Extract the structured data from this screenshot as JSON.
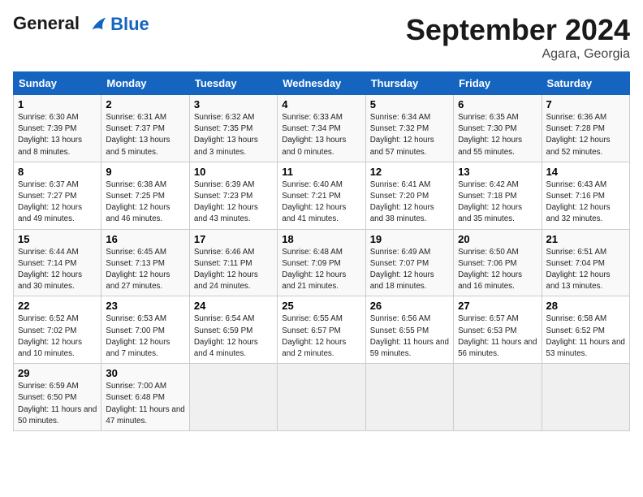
{
  "header": {
    "logo_line1": "General",
    "logo_line2": "Blue",
    "month": "September 2024",
    "location": "Agara, Georgia"
  },
  "days_of_week": [
    "Sunday",
    "Monday",
    "Tuesday",
    "Wednesday",
    "Thursday",
    "Friday",
    "Saturday"
  ],
  "weeks": [
    [
      {
        "day": 1,
        "sunrise": "6:30 AM",
        "sunset": "7:39 PM",
        "daylight": "13 hours and 8 minutes."
      },
      {
        "day": 2,
        "sunrise": "6:31 AM",
        "sunset": "7:37 PM",
        "daylight": "13 hours and 5 minutes."
      },
      {
        "day": 3,
        "sunrise": "6:32 AM",
        "sunset": "7:35 PM",
        "daylight": "13 hours and 3 minutes."
      },
      {
        "day": 4,
        "sunrise": "6:33 AM",
        "sunset": "7:34 PM",
        "daylight": "13 hours and 0 minutes."
      },
      {
        "day": 5,
        "sunrise": "6:34 AM",
        "sunset": "7:32 PM",
        "daylight": "12 hours and 57 minutes."
      },
      {
        "day": 6,
        "sunrise": "6:35 AM",
        "sunset": "7:30 PM",
        "daylight": "12 hours and 55 minutes."
      },
      {
        "day": 7,
        "sunrise": "6:36 AM",
        "sunset": "7:28 PM",
        "daylight": "12 hours and 52 minutes."
      }
    ],
    [
      {
        "day": 8,
        "sunrise": "6:37 AM",
        "sunset": "7:27 PM",
        "daylight": "12 hours and 49 minutes."
      },
      {
        "day": 9,
        "sunrise": "6:38 AM",
        "sunset": "7:25 PM",
        "daylight": "12 hours and 46 minutes."
      },
      {
        "day": 10,
        "sunrise": "6:39 AM",
        "sunset": "7:23 PM",
        "daylight": "12 hours and 43 minutes."
      },
      {
        "day": 11,
        "sunrise": "6:40 AM",
        "sunset": "7:21 PM",
        "daylight": "12 hours and 41 minutes."
      },
      {
        "day": 12,
        "sunrise": "6:41 AM",
        "sunset": "7:20 PM",
        "daylight": "12 hours and 38 minutes."
      },
      {
        "day": 13,
        "sunrise": "6:42 AM",
        "sunset": "7:18 PM",
        "daylight": "12 hours and 35 minutes."
      },
      {
        "day": 14,
        "sunrise": "6:43 AM",
        "sunset": "7:16 PM",
        "daylight": "12 hours and 32 minutes."
      }
    ],
    [
      {
        "day": 15,
        "sunrise": "6:44 AM",
        "sunset": "7:14 PM",
        "daylight": "12 hours and 30 minutes."
      },
      {
        "day": 16,
        "sunrise": "6:45 AM",
        "sunset": "7:13 PM",
        "daylight": "12 hours and 27 minutes."
      },
      {
        "day": 17,
        "sunrise": "6:46 AM",
        "sunset": "7:11 PM",
        "daylight": "12 hours and 24 minutes."
      },
      {
        "day": 18,
        "sunrise": "6:48 AM",
        "sunset": "7:09 PM",
        "daylight": "12 hours and 21 minutes."
      },
      {
        "day": 19,
        "sunrise": "6:49 AM",
        "sunset": "7:07 PM",
        "daylight": "12 hours and 18 minutes."
      },
      {
        "day": 20,
        "sunrise": "6:50 AM",
        "sunset": "7:06 PM",
        "daylight": "12 hours and 16 minutes."
      },
      {
        "day": 21,
        "sunrise": "6:51 AM",
        "sunset": "7:04 PM",
        "daylight": "12 hours and 13 minutes."
      }
    ],
    [
      {
        "day": 22,
        "sunrise": "6:52 AM",
        "sunset": "7:02 PM",
        "daylight": "12 hours and 10 minutes."
      },
      {
        "day": 23,
        "sunrise": "6:53 AM",
        "sunset": "7:00 PM",
        "daylight": "12 hours and 7 minutes."
      },
      {
        "day": 24,
        "sunrise": "6:54 AM",
        "sunset": "6:59 PM",
        "daylight": "12 hours and 4 minutes."
      },
      {
        "day": 25,
        "sunrise": "6:55 AM",
        "sunset": "6:57 PM",
        "daylight": "12 hours and 2 minutes."
      },
      {
        "day": 26,
        "sunrise": "6:56 AM",
        "sunset": "6:55 PM",
        "daylight": "11 hours and 59 minutes."
      },
      {
        "day": 27,
        "sunrise": "6:57 AM",
        "sunset": "6:53 PM",
        "daylight": "11 hours and 56 minutes."
      },
      {
        "day": 28,
        "sunrise": "6:58 AM",
        "sunset": "6:52 PM",
        "daylight": "11 hours and 53 minutes."
      }
    ],
    [
      {
        "day": 29,
        "sunrise": "6:59 AM",
        "sunset": "6:50 PM",
        "daylight": "11 hours and 50 minutes."
      },
      {
        "day": 30,
        "sunrise": "7:00 AM",
        "sunset": "6:48 PM",
        "daylight": "11 hours and 47 minutes."
      },
      null,
      null,
      null,
      null,
      null
    ]
  ]
}
